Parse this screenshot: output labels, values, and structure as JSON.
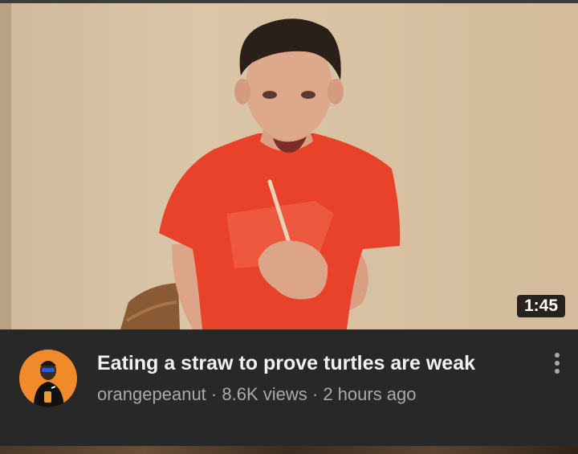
{
  "video": {
    "duration": "1:45",
    "title": "Eating a straw to prove turtles are weak",
    "channel": "orangepeanut",
    "views": "8.6K views",
    "age": "2 hours ago",
    "separator": " · "
  },
  "avatar": {
    "bg_color": "#f08a2a"
  },
  "menu": {
    "icon": "more-vert-icon"
  }
}
